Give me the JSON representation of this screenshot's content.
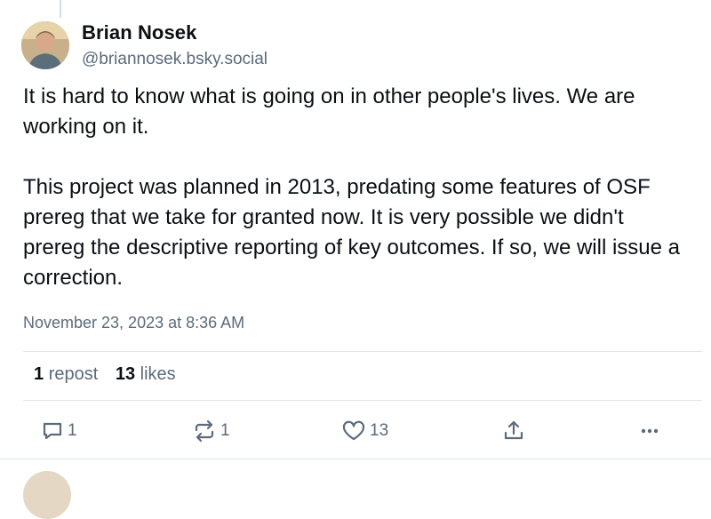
{
  "post": {
    "author_name": "Brian Nosek",
    "author_handle": "@briannosek.bsky.social",
    "text_paragraphs": [
      "It is hard to know what is going on in other people's lives. We are working on it.",
      "This project was planned in 2013, predating some features of OSF prereg that we take for granted now. It is very possible we didn't prereg the descriptive reporting of key outcomes. If so, we will issue a correction."
    ],
    "timestamp": "November 23, 2023 at 8:36 AM"
  },
  "stats": {
    "repost_count": "1",
    "repost_label": "repost",
    "like_count": "13",
    "like_label": "likes"
  },
  "actions": {
    "reply_count": "1",
    "repost_count": "1",
    "like_count": "13"
  },
  "icons": {
    "reply": "speech-bubble-icon",
    "repost": "repost-arrows-icon",
    "like": "heart-icon",
    "share": "share-upload-icon",
    "more": "ellipsis-icon"
  },
  "colors": {
    "text_primary": "#0b0f14",
    "text_secondary": "#5b6b7c",
    "divider": "#dfe4ea"
  }
}
